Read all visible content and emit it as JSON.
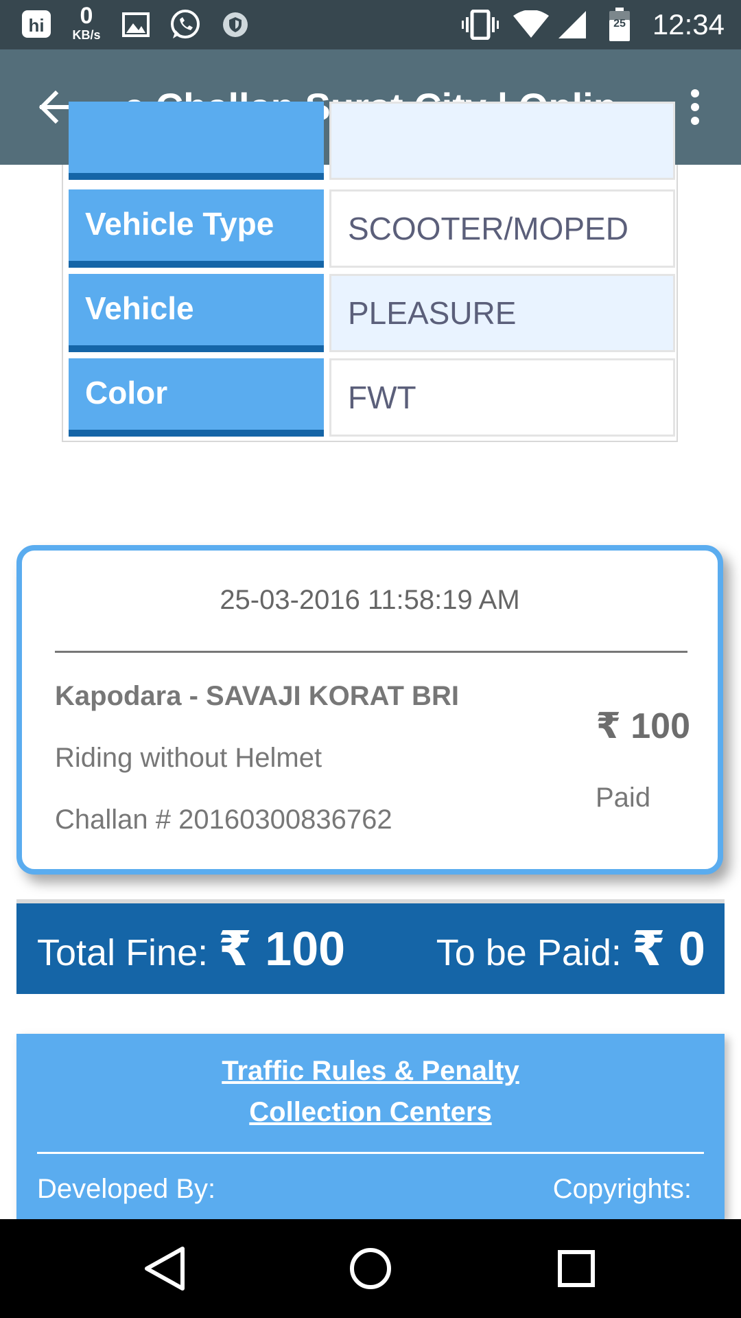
{
  "status_bar": {
    "time": "12:34",
    "data_speed_value": "0",
    "data_speed_unit": "KB/s",
    "battery_level": "25",
    "left_icons": [
      "hike-icon",
      "data-speed-icon",
      "gallery-icon",
      "whatsapp-icon",
      "shield-icon"
    ],
    "right_icons": [
      "vibrate-icon",
      "wifi-icon",
      "signal-icon",
      "battery-icon"
    ]
  },
  "app_bar": {
    "title": "e Challan Surat City | Onlin…",
    "back_icon": "arrow-back-icon",
    "menu_icon": "more-vert-icon"
  },
  "vehicle_details": [
    {
      "label": "Vehicle Type",
      "value": "SCOOTER/MOPED"
    },
    {
      "label": "Vehicle",
      "value": "PLEASURE"
    },
    {
      "label": "Color",
      "value": "FWT"
    }
  ],
  "challan": {
    "datetime": "25-03-2016 11:58:19 AM",
    "location": "Kapodara - SAVAJI KORAT BRI",
    "offence": "Riding without Helmet",
    "challan_number": "Challan # 20160300836762",
    "amount": "₹ 100",
    "status": "Paid"
  },
  "totals": {
    "total_label": "Total Fine:",
    "total_value": "₹ 100",
    "to_pay_label": "To be Paid:",
    "to_pay_value": "₹ 0"
  },
  "footer": {
    "link_line1": "Traffic Rules & Penalty",
    "link_line2": "Collection Centers",
    "developed_by": "Developed By:",
    "copyrights": "Copyrights:"
  },
  "colors": {
    "status_bar": "#37474f",
    "app_bar": "#546e7a",
    "label_blue": "#5aacef",
    "dark_blue": "#1565a7"
  }
}
